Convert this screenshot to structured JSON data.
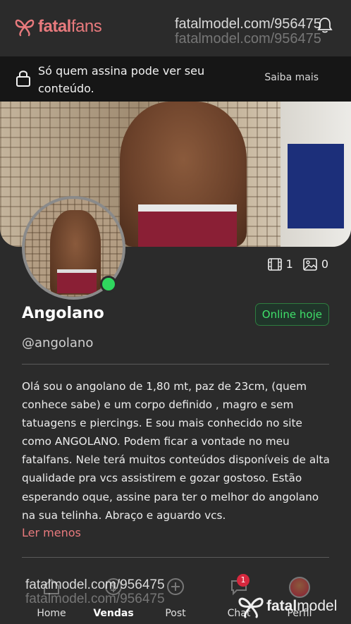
{
  "header": {
    "logo_bold": "fatal",
    "logo_light": "fans",
    "watermark": "fatalmodel.com/956475"
  },
  "notice": {
    "text": "Só quem assina pode ver seu conteúdo.",
    "link": "Saiba mais"
  },
  "profile": {
    "name": "Angolano",
    "handle": "@angolano",
    "status_badge": "Online hoje",
    "videos_count": "1",
    "photos_count": "0",
    "bio": "Olá sou o angolano de 1,80 mt, paz de 23cm, (quem conhece sabe) e um corpo definido , magro e sem tatuagens e piercings. E sou mais conhecido no site como ANGOLANO. Podem ficar a vontade no meu fatalfans. Nele terá muitos conteúdos disponíveis de alta qualidade pra vcs assistirem e gozar gostoso. Estão esperando oque, assine para ter o melhor do angolano na sua telinha. Abraço e aguardo vcs.",
    "toggle_label": "Ler menos"
  },
  "bottom_nav": {
    "items": [
      {
        "label": "Home"
      },
      {
        "label": "Vendas"
      },
      {
        "label": "Post"
      },
      {
        "label": "Chat"
      },
      {
        "label": "Perfil"
      }
    ],
    "chat_unread": "1"
  },
  "watermark_brand": {
    "bold": "fatal",
    "light": "model"
  },
  "colors": {
    "background": "#2b2b2b",
    "brand": "#e87a7d",
    "online": "#2fd65e",
    "notice_bg": "#161616",
    "badge_red": "#d6283e"
  }
}
